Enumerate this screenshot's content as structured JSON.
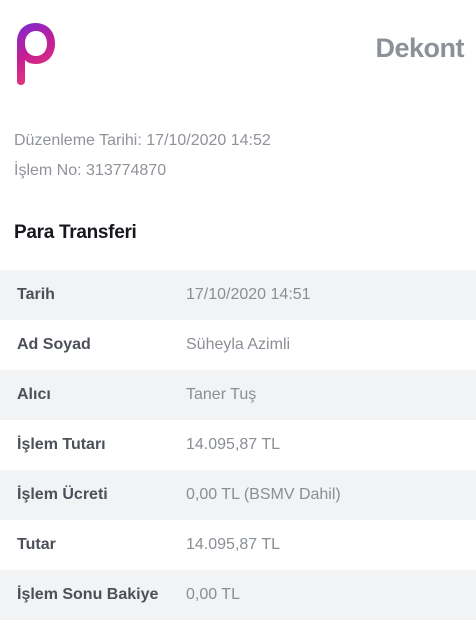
{
  "header": {
    "logo_icon": "brand-p-logo",
    "title": "Dekont",
    "brand_gradient": [
      "#6b2bd9",
      "#c8208f",
      "#e8347a"
    ]
  },
  "meta": {
    "issue_date": "Düzenleme Tarihi: 17/10/2020 14:52",
    "transaction_no": "İşlem No: 313774870"
  },
  "section": {
    "title": "Para Transferi"
  },
  "details": [
    {
      "label": "Tarih",
      "value": "17/10/2020 14:51"
    },
    {
      "label": "Ad Soyad",
      "value": "Süheyla Azimli"
    },
    {
      "label": "Alıcı",
      "value": "Taner Tuş"
    },
    {
      "label": "İşlem Tutarı",
      "value": "14.095,87 TL"
    },
    {
      "label": "İşlem Ücreti",
      "value": "0,00 TL (BSMV Dahil)"
    },
    {
      "label": "Tutar",
      "value": "14.095,87 TL"
    },
    {
      "label": "İşlem Sonu Bakiye",
      "value": "0,00 TL"
    }
  ]
}
